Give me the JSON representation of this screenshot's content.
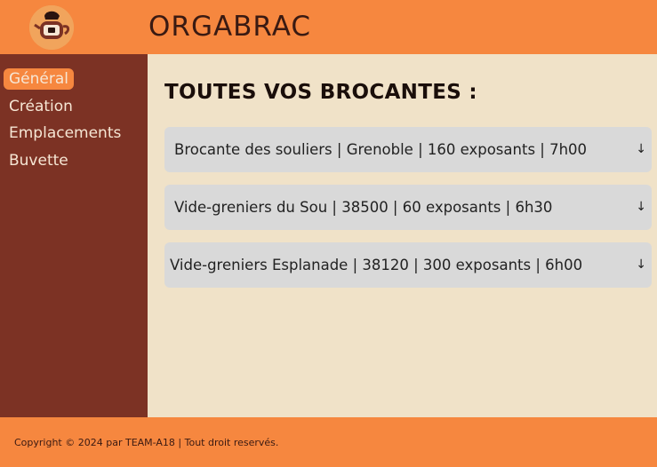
{
  "header": {
    "title": "ORGABRAC",
    "logo_icon": "teapot-icon"
  },
  "sidebar": {
    "items": [
      {
        "label": "Général",
        "active": true
      },
      {
        "label": "Création",
        "active": false
      },
      {
        "label": "Emplacements",
        "active": false
      },
      {
        "label": "Buvette",
        "active": false
      }
    ]
  },
  "main": {
    "title": "TOUTES VOS BROCANTES :",
    "brocantes": [
      {
        "label": "Brocante des souliers | Grenoble  | 160 exposants | 7h00",
        "arrow": "↓"
      },
      {
        "label": "Vide-greniers du Sou | 38500 | 60 exposants | 6h30",
        "arrow": "↓"
      },
      {
        "label": "Vide-greniers Esplanade | 38120 | 300 exposants | 6h00",
        "arrow": "↓"
      }
    ]
  },
  "footer": {
    "text": "Copyright © 2024 par TEAM-A18 | Tout droit reservés."
  },
  "colors": {
    "header_bg": "#f6873f",
    "sidebar_bg": "#7c3224",
    "main_bg": "#f0e2c8",
    "card_bg": "#d9d9d9",
    "active_nav_bg": "#f6873f"
  }
}
